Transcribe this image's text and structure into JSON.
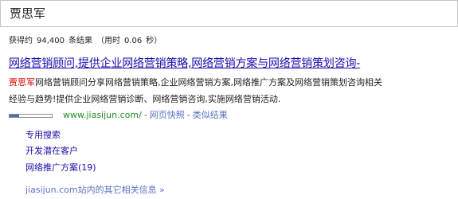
{
  "search": {
    "query": "贾思军"
  },
  "stats": {
    "prefix": "获得约",
    "count": "94,400",
    "suffix": "条结果",
    "time_open": "（用时",
    "time_value": "0.06",
    "time_close": "秒）"
  },
  "result": {
    "title": "网络营销顾问,提供企业网络营销策略,网络营销方案与网络营销策划咨询-",
    "snippet": {
      "highlight": "贾思军",
      "line1_rest": "网络营销顾问分享网络营销策略,企业网络营销方案,网络推广方案及网络营销策划咨询相关",
      "line2": "经验与趋势!提供企业网络营销诊断、网络营销咨询,实施网络营销活动."
    },
    "pagerank": {
      "level": 0.22
    },
    "url": "www.jiasijun.com/",
    "separator": "-",
    "cache_label": "网页快照",
    "similar_label": "类似结果",
    "colors": {
      "title": "#1a0dab",
      "url": "#228b22",
      "highlight": "#cc0000",
      "pagerank_fill": "#4a6db3"
    }
  },
  "sitelinks": [
    {
      "label": "专用搜索"
    },
    {
      "label": "开发潜在客户"
    },
    {
      "label": "网络推广方案(19)"
    }
  ],
  "more_from_site": "jiasijun.com站内的其它相关信息 »"
}
